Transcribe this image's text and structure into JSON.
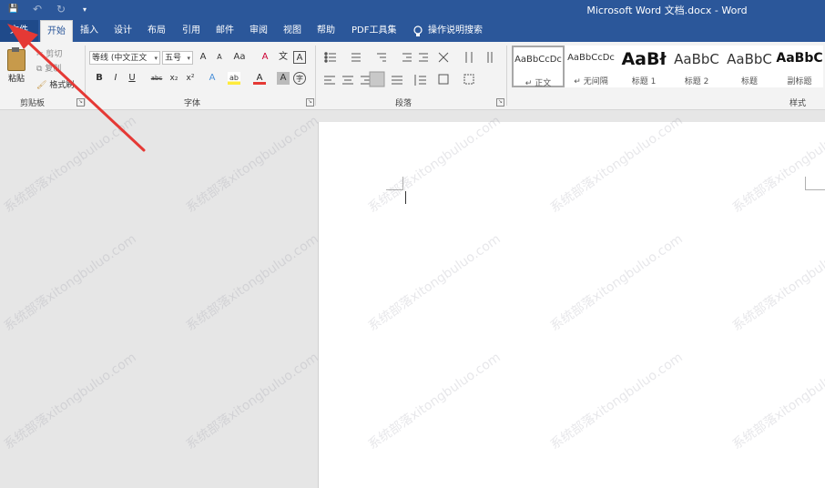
{
  "window": {
    "title": "Microsoft Word 文档.docx  -  Word"
  },
  "qat": {
    "save": "💾",
    "undo": "↶",
    "redo": "↻",
    "more": "▾"
  },
  "tabs": {
    "file": "文件",
    "home": "开始",
    "insert": "插入",
    "design": "设计",
    "layout": "布局",
    "references": "引用",
    "mailings": "邮件",
    "review": "审阅",
    "view": "视图",
    "help": "帮助",
    "pdf": "PDF工具集",
    "tellme": "操作说明搜索"
  },
  "clipboard": {
    "paste": "粘贴",
    "cut": "剪切",
    "copy": "复制",
    "format_painter": "格式刷",
    "label": "剪贴板"
  },
  "font": {
    "name": "等线 (中文正文",
    "size": "五号",
    "label": "字体",
    "bold": "B",
    "italic": "I",
    "underline": "U",
    "strike": "abc",
    "sub": "x₂",
    "sup": "x²",
    "grow": "A",
    "shrink": "A",
    "case": "Aa",
    "clear": "A",
    "pinyin": "文",
    "border": "A",
    "effects": "A",
    "highlight": "ab",
    "color": "A",
    "shade": "A",
    "circle": "字"
  },
  "paragraph": {
    "label": "段落"
  },
  "styles": {
    "label": "样式",
    "items": [
      {
        "sample": "AaBbCcDc",
        "name": "↵ 正文"
      },
      {
        "sample": "AaBbCcDc",
        "name": "↵ 无间隔"
      },
      {
        "sample": "AaBł",
        "name": "标题 1"
      },
      {
        "sample": "AaBbC",
        "name": "标题 2"
      },
      {
        "sample": "AaBbC",
        "name": "标题"
      },
      {
        "sample": "AaBbC",
        "name": "副标题"
      }
    ]
  },
  "watermark": {
    "text": "系统部落xitongbuluo.com"
  },
  "colors": {
    "accent": "#2b579a",
    "arrow": "#e53935"
  }
}
